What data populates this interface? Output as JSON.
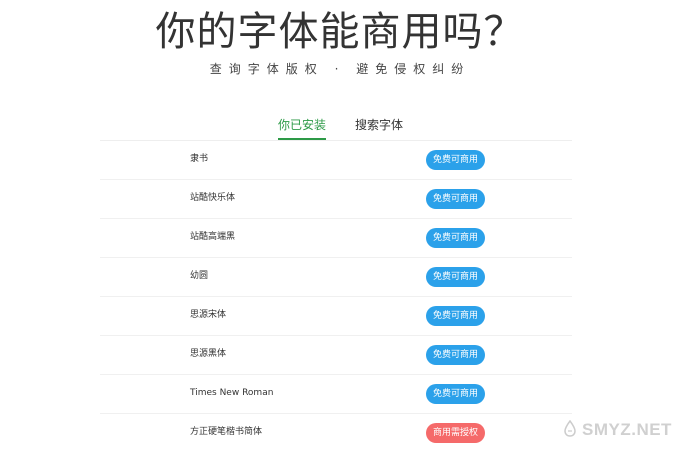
{
  "header": {
    "title": "你的字体能商用吗？",
    "subtitle": "查询字体版权 · 避免侵权纠纷"
  },
  "tabs": [
    {
      "label": "你已安装",
      "active": true
    },
    {
      "label": "搜索字体",
      "active": false
    }
  ],
  "fonts": [
    {
      "name": "隶书",
      "status": "免费可商用",
      "status_type": "free"
    },
    {
      "name": "站酷快乐体",
      "status": "免费可商用",
      "status_type": "free"
    },
    {
      "name": "站酷高端黑",
      "status": "免费可商用",
      "status_type": "free"
    },
    {
      "name": "幼圆",
      "status": "免费可商用",
      "status_type": "free"
    },
    {
      "name": "思源宋体",
      "status": "免费可商用",
      "status_type": "free"
    },
    {
      "name": "思源黑体",
      "status": "免费可商用",
      "status_type": "free"
    },
    {
      "name": "Times New Roman",
      "status": "免费可商用",
      "status_type": "free"
    },
    {
      "name": "方正硬笔楷书简体",
      "status": "商用需授权",
      "status_type": "paid"
    }
  ],
  "colors": {
    "accent": "#2d9a47",
    "free_badge": "#2ba1ea",
    "paid_badge": "#f56a6a"
  },
  "watermark": {
    "text": "SMYZ.NET",
    "icon": "smyz-logo-icon"
  }
}
